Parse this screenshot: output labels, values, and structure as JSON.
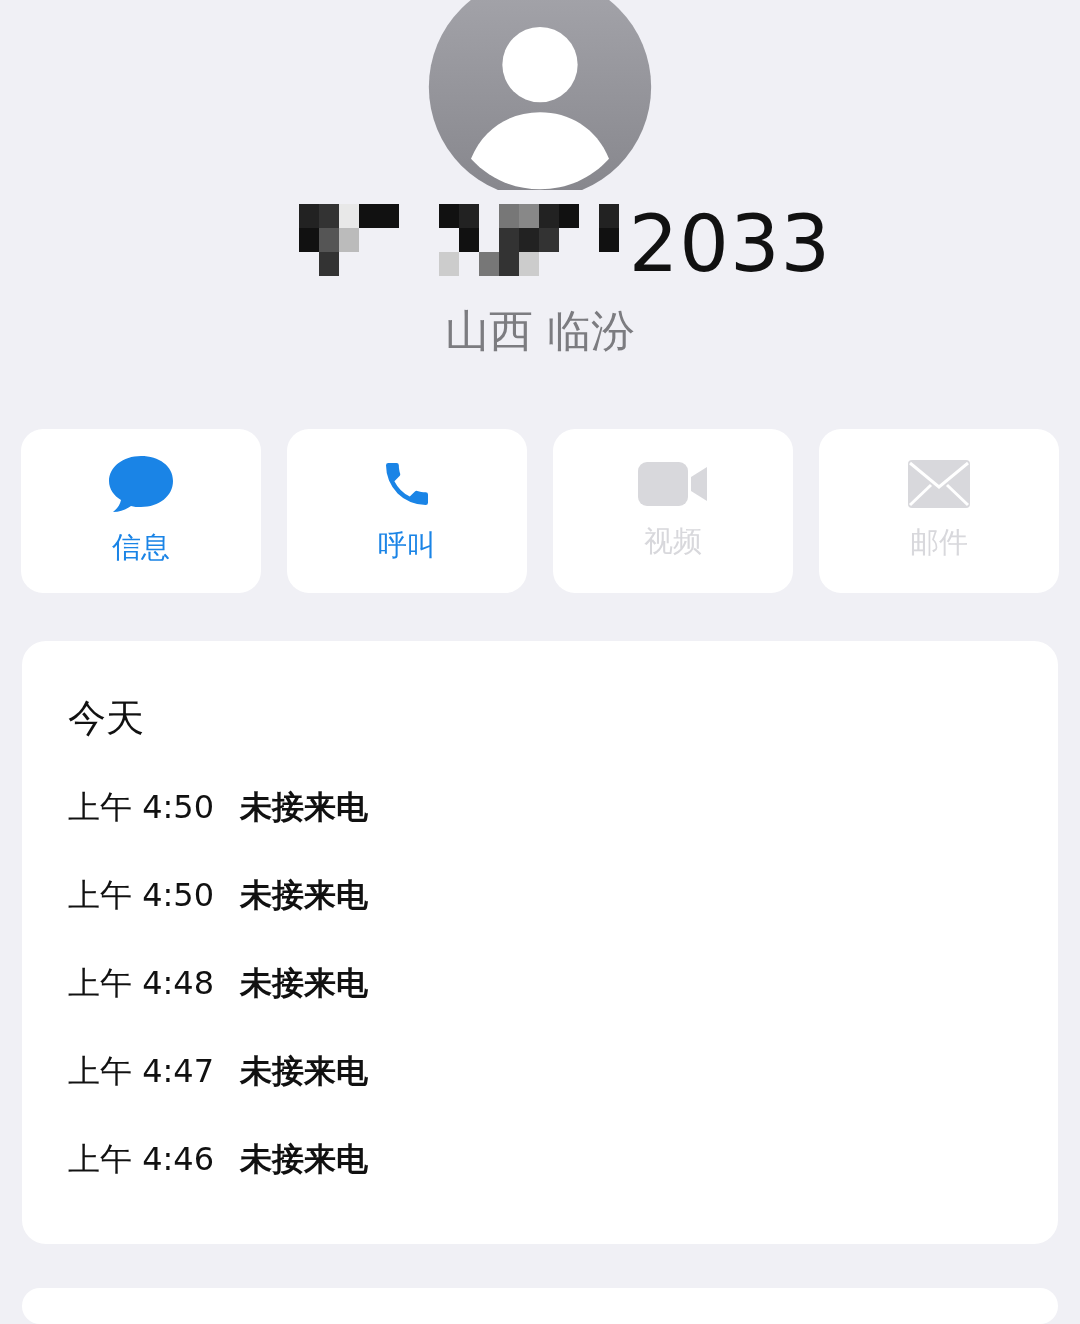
{
  "contact": {
    "number_visible": "2033",
    "location": "山西 临汾"
  },
  "actions": [
    {
      "kind": "message",
      "label": "信息",
      "disabled": false
    },
    {
      "kind": "call",
      "label": "呼叫",
      "disabled": false
    },
    {
      "kind": "video",
      "label": "视频",
      "disabled": true
    },
    {
      "kind": "mail",
      "label": "邮件",
      "disabled": true
    }
  ],
  "history": {
    "heading": "今天",
    "calls": [
      {
        "time": "上午 4:50",
        "status": "未接来电"
      },
      {
        "time": "上午 4:50",
        "status": "未接来电"
      },
      {
        "time": "上午 4:48",
        "status": "未接来电"
      },
      {
        "time": "上午 4:47",
        "status": "未接来电"
      },
      {
        "time": "上午 4:46",
        "status": "未接来电"
      }
    ]
  }
}
